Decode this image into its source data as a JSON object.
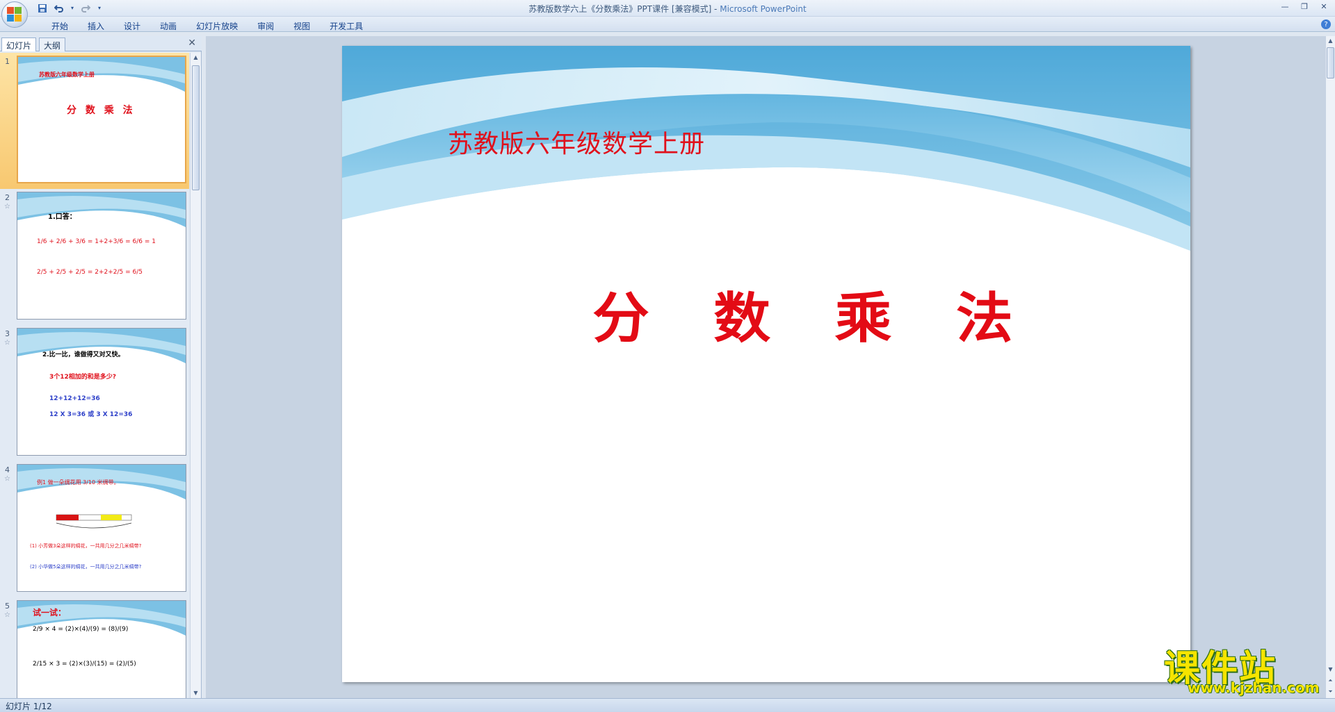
{
  "window": {
    "title_doc": "苏教版数学六上《分数乘法》PPT课件 [兼容模式] - ",
    "title_app": "Microsoft PowerPoint"
  },
  "ribbon": {
    "tabs": [
      "开始",
      "插入",
      "设计",
      "动画",
      "幻灯片放映",
      "审阅",
      "视图",
      "开发工具"
    ]
  },
  "left_pane": {
    "tab_slides": "幻灯片",
    "tab_outline": "大纲",
    "thumbnails": [
      {
        "num": "1",
        "line1": "苏教版六年级数学上册",
        "line2": "分 数 乘 法"
      },
      {
        "num": "2",
        "line1": "1.口答：",
        "line2": "1/6 + 2/6 + 3/6 = 1+2+3/6 = 6/6 = 1",
        "line3": "2/5 + 2/5 + 2/5 = 2+2+2/5 = 6/5"
      },
      {
        "num": "3",
        "line1": "2.比一比，谁做得又对又快。",
        "line2": "3个12相加的和是多少?",
        "line3": "12+12+12=36",
        "line4": "12 X 3=36 或 3 X 12=36"
      },
      {
        "num": "4",
        "line1": "例1  做一朵绸花用 3/10 米绸带。",
        "line2": "(1) 小芳做3朵这样的绸花，一共用几分之几米绸带?",
        "line3": "(2) 小华做5朵这样的绸花，一共用几分之几米绸带?"
      },
      {
        "num": "5",
        "line1": "试一试：",
        "line2": "2/9 × 4 = (2)×(4)/(9) = (8)/(9)",
        "line3": "2/15 × 3 = (2)×(3)/(15) = (2)/(5)"
      }
    ]
  },
  "slide": {
    "subtitle": "苏教版六年级数学上册",
    "title": "分数乘法"
  },
  "status": {
    "slide_counter": "幻灯片 1/12"
  },
  "watermark": {
    "main": "课件站",
    "url": "www.kjzhan.com"
  },
  "colors": {
    "title_red": "#e30b15",
    "wave_blue": "#5fb0dc",
    "selection_orange": "#f8c870"
  }
}
